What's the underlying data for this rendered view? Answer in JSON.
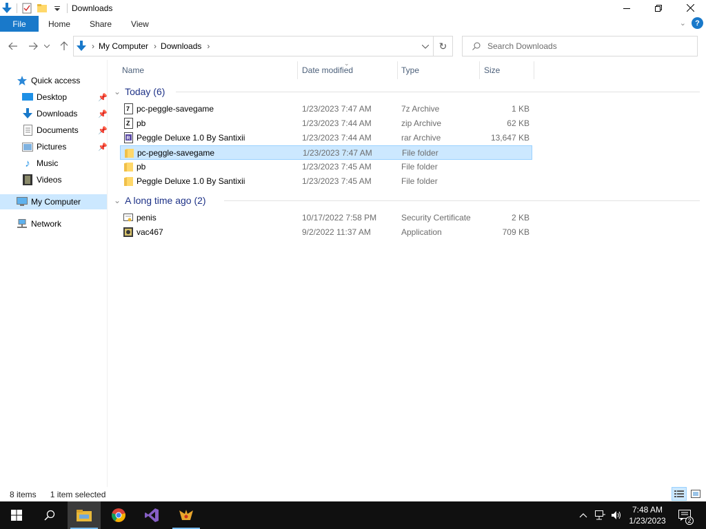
{
  "window": {
    "title": "Downloads"
  },
  "ribbon": {
    "file": "File",
    "tabs": [
      "Home",
      "Share",
      "View"
    ]
  },
  "address": {
    "crumbs": [
      "My Computer",
      "Downloads"
    ]
  },
  "search": {
    "placeholder": "Search Downloads"
  },
  "sidebar": {
    "quick_access": "Quick access",
    "items": [
      {
        "label": "Desktop",
        "icon": "desktop-icon",
        "pinned": true
      },
      {
        "label": "Downloads",
        "icon": "downloads-icon",
        "pinned": true
      },
      {
        "label": "Documents",
        "icon": "documents-icon",
        "pinned": true
      },
      {
        "label": "Pictures",
        "icon": "pictures-icon",
        "pinned": true
      },
      {
        "label": "Music",
        "icon": "music-icon",
        "pinned": false
      },
      {
        "label": "Videos",
        "icon": "videos-icon",
        "pinned": false
      }
    ],
    "my_computer": "My Computer",
    "network": "Network"
  },
  "columns": {
    "name": "Name",
    "date": "Date modified",
    "type": "Type",
    "size": "Size"
  },
  "groups": [
    {
      "label": "Today (6)",
      "rows": [
        {
          "name": "pc-peggle-savegame",
          "date": "1/23/2023 7:47 AM",
          "type": "7z Archive",
          "size": "1 KB",
          "icon": "7z-archive-icon",
          "selected": false
        },
        {
          "name": "pb",
          "date": "1/23/2023 7:44 AM",
          "type": "zip Archive",
          "size": "62 KB",
          "icon": "zip-archive-icon",
          "selected": false
        },
        {
          "name": "Peggle Deluxe 1.0 By Santixii",
          "date": "1/23/2023 7:44 AM",
          "type": "rar Archive",
          "size": "13,647 KB",
          "icon": "rar-archive-icon",
          "selected": false
        },
        {
          "name": "pc-peggle-savegame",
          "date": "1/23/2023 7:47 AM",
          "type": "File folder",
          "size": "",
          "icon": "folder-icon",
          "selected": true
        },
        {
          "name": "pb",
          "date": "1/23/2023 7:45 AM",
          "type": "File folder",
          "size": "",
          "icon": "folder-icon",
          "selected": false
        },
        {
          "name": "Peggle Deluxe 1.0 By Santixii",
          "date": "1/23/2023 7:45 AM",
          "type": "File folder",
          "size": "",
          "icon": "folder-icon",
          "selected": false
        }
      ]
    },
    {
      "label": "A long time ago (2)",
      "rows": [
        {
          "name": "penis",
          "date": "10/17/2022 7:58 PM",
          "type": "Security Certificate",
          "size": "2 KB",
          "icon": "certificate-icon",
          "selected": false
        },
        {
          "name": "vac467",
          "date": "9/2/2022 11:37 AM",
          "type": "Application",
          "size": "709 KB",
          "icon": "application-icon",
          "selected": false
        }
      ]
    }
  ],
  "status": {
    "count": "8 items",
    "selection": "1 item selected"
  },
  "taskbar": {
    "time": "7:48 AM",
    "date": "1/23/2023",
    "notifications": "2"
  },
  "colors": {
    "accent": "#1979ca",
    "selection": "#cce8ff",
    "selection_border": "#99d1ff",
    "group_header": "#1e3287",
    "taskbar": "#101010"
  }
}
